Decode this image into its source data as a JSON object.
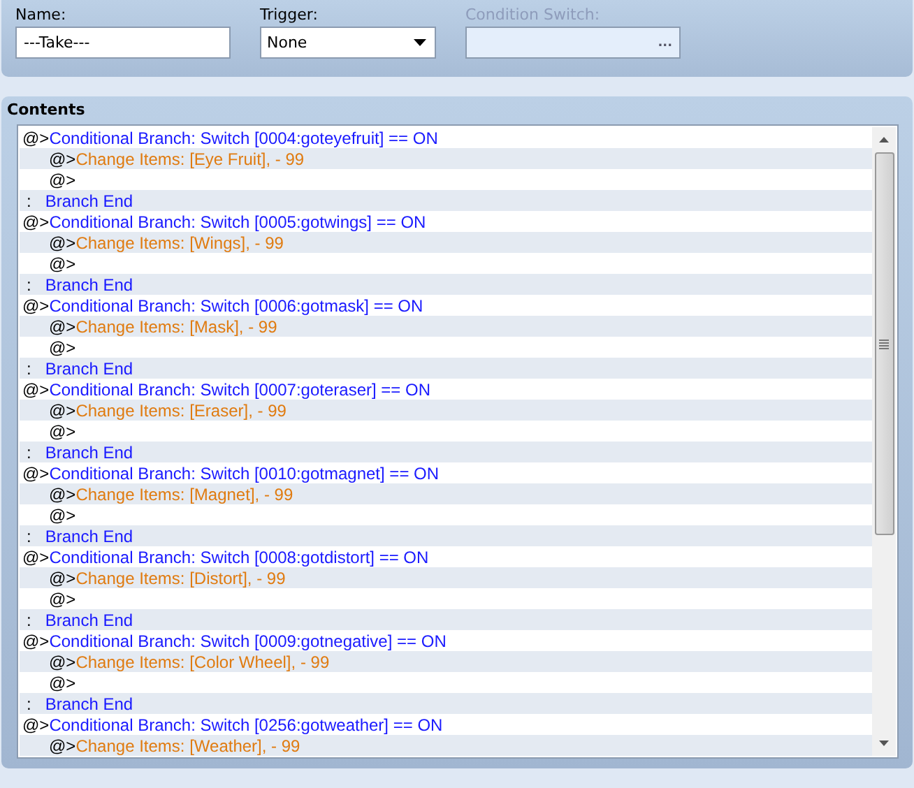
{
  "fields": {
    "name": {
      "label": "Name:",
      "value": "---Take---"
    },
    "trigger": {
      "label": "Trigger:",
      "value": "None"
    },
    "condition_switch": {
      "label": "Condition Switch:",
      "disabled": true,
      "button": "..."
    }
  },
  "contents": {
    "title": "Contents",
    "rows": [
      {
        "kind": "branch",
        "prefix": "@>",
        "text": "Conditional Branch: Switch [0004:goteyefruit] == ON"
      },
      {
        "kind": "item",
        "prefix": "@>",
        "text": "Change Items: [Eye Fruit], - 99"
      },
      {
        "kind": "empty",
        "prefix": "@>"
      },
      {
        "kind": "end",
        "prefix": ":",
        "text": "Branch End"
      },
      {
        "kind": "branch",
        "prefix": "@>",
        "text": "Conditional Branch: Switch [0005:gotwings] == ON"
      },
      {
        "kind": "item",
        "prefix": "@>",
        "text": "Change Items: [Wings], - 99"
      },
      {
        "kind": "empty",
        "prefix": "@>"
      },
      {
        "kind": "end",
        "prefix": ":",
        "text": "Branch End"
      },
      {
        "kind": "branch",
        "prefix": "@>",
        "text": "Conditional Branch: Switch [0006:gotmask] == ON"
      },
      {
        "kind": "item",
        "prefix": "@>",
        "text": "Change Items: [Mask], - 99"
      },
      {
        "kind": "empty",
        "prefix": "@>"
      },
      {
        "kind": "end",
        "prefix": ":",
        "text": "Branch End"
      },
      {
        "kind": "branch",
        "prefix": "@>",
        "text": "Conditional Branch: Switch [0007:goteraser] == ON"
      },
      {
        "kind": "item",
        "prefix": "@>",
        "text": "Change Items: [Eraser], - 99"
      },
      {
        "kind": "empty",
        "prefix": "@>"
      },
      {
        "kind": "end",
        "prefix": ":",
        "text": "Branch End"
      },
      {
        "kind": "branch",
        "prefix": "@>",
        "text": "Conditional Branch: Switch [0010:gotmagnet] == ON"
      },
      {
        "kind": "item",
        "prefix": "@>",
        "text": "Change Items: [Magnet], - 99"
      },
      {
        "kind": "empty",
        "prefix": "@>"
      },
      {
        "kind": "end",
        "prefix": ":",
        "text": "Branch End"
      },
      {
        "kind": "branch",
        "prefix": "@>",
        "text": "Conditional Branch: Switch [0008:gotdistort] == ON"
      },
      {
        "kind": "item",
        "prefix": "@>",
        "text": "Change Items: [Distort], - 99"
      },
      {
        "kind": "empty",
        "prefix": "@>"
      },
      {
        "kind": "end",
        "prefix": ":",
        "text": "Branch End"
      },
      {
        "kind": "branch",
        "prefix": "@>",
        "text": "Conditional Branch: Switch [0009:gotnegative] == ON"
      },
      {
        "kind": "item",
        "prefix": "@>",
        "text": "Change Items: [Color Wheel], - 99"
      },
      {
        "kind": "empty",
        "prefix": "@>"
      },
      {
        "kind": "end",
        "prefix": ":",
        "text": "Branch End"
      },
      {
        "kind": "branch",
        "prefix": "@>",
        "text": "Conditional Branch: Switch [0256:gotweather] == ON"
      },
      {
        "kind": "item",
        "prefix": "@>",
        "text": "Change Items: [Weather], - 99"
      }
    ]
  }
}
